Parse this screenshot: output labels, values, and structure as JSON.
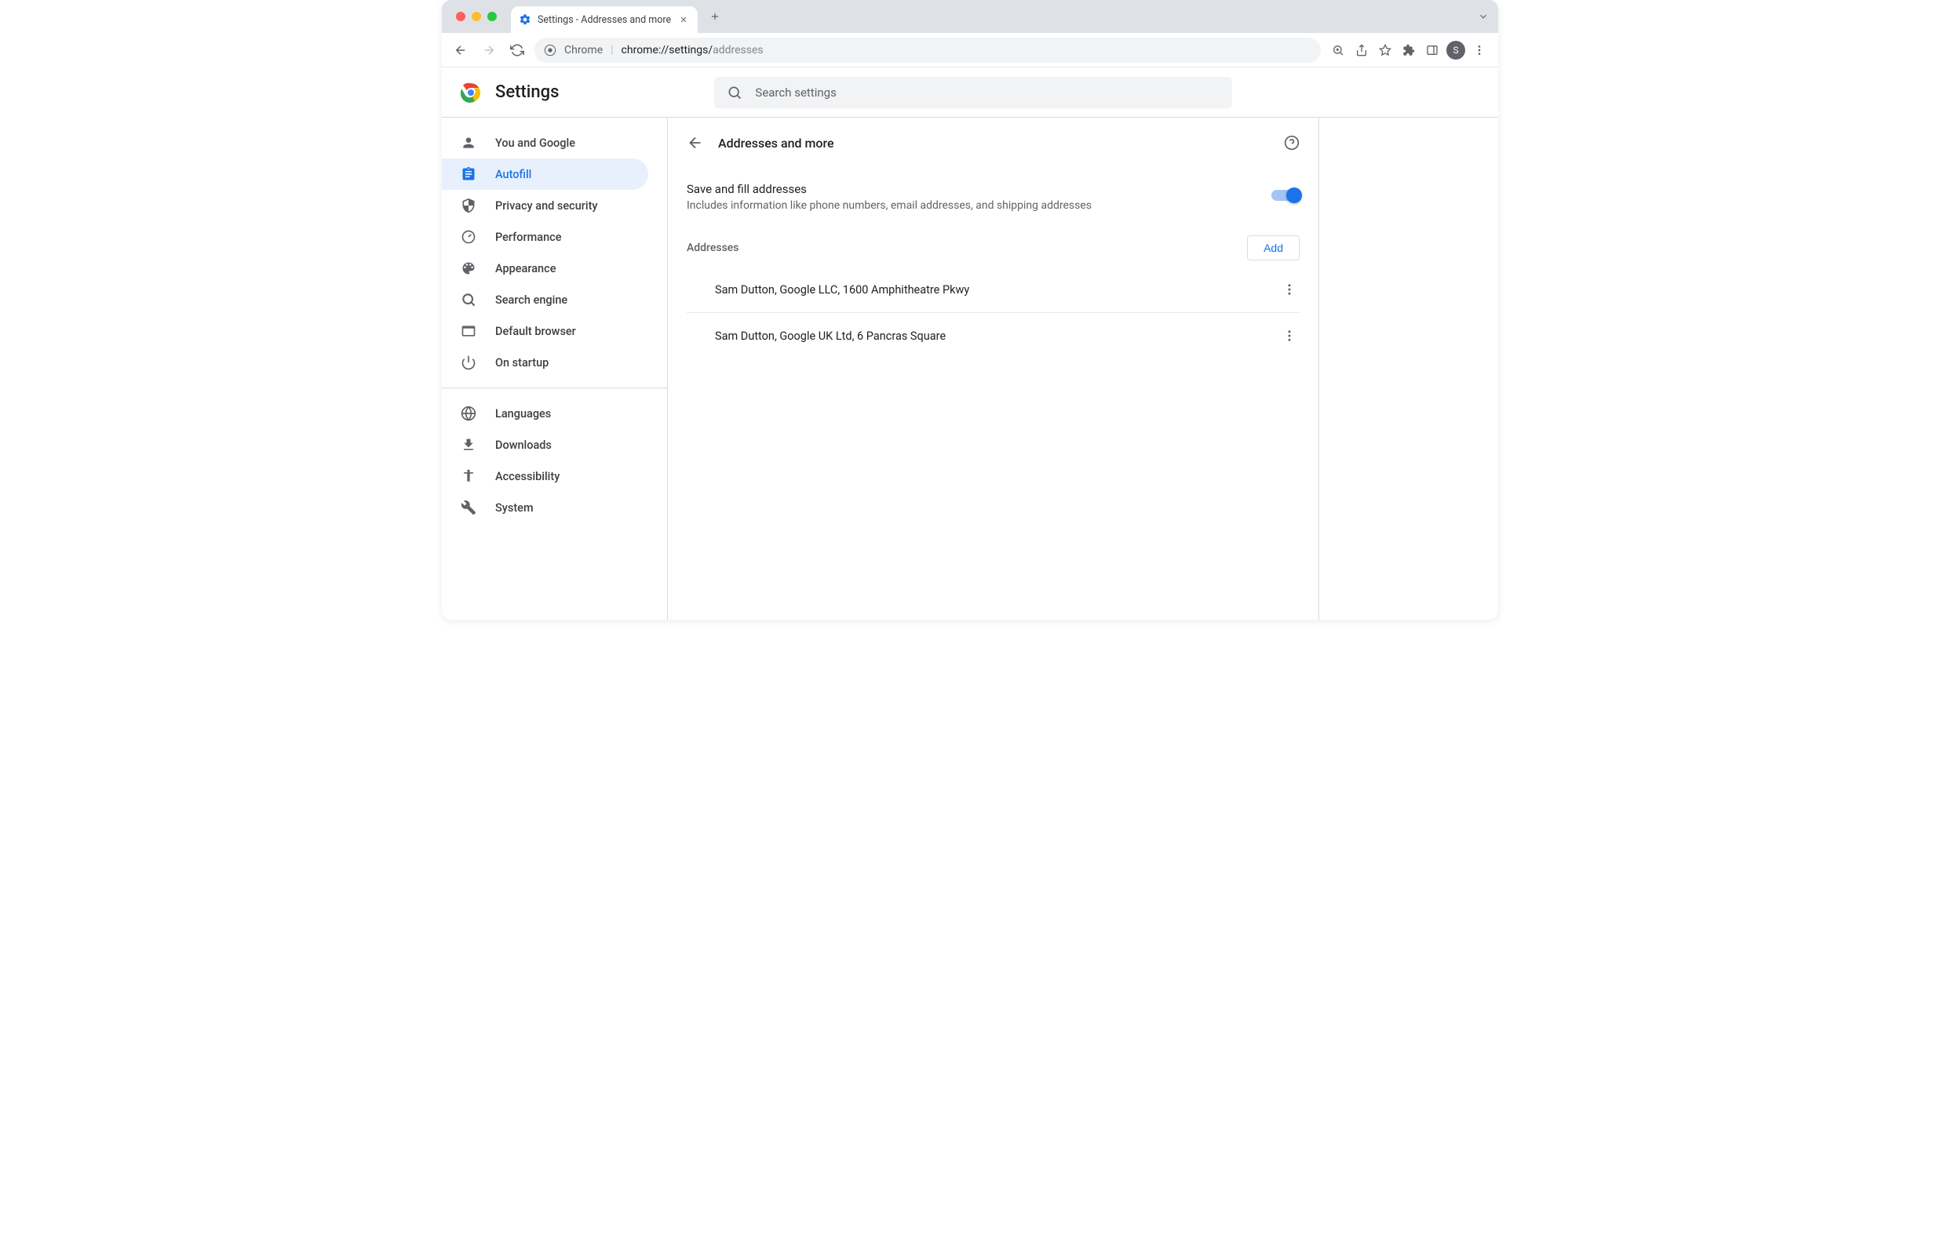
{
  "tab": {
    "title": "Settings - Addresses and more"
  },
  "omnibox": {
    "label": "Chrome",
    "url_prefix": "chrome://",
    "url_bold": "settings/",
    "url_faded": "addresses"
  },
  "avatar_initial": "S",
  "header": {
    "title": "Settings",
    "search_placeholder": "Search settings"
  },
  "sidebar": {
    "items": [
      {
        "label": "You and Google"
      },
      {
        "label": "Autofill"
      },
      {
        "label": "Privacy and security"
      },
      {
        "label": "Performance"
      },
      {
        "label": "Appearance"
      },
      {
        "label": "Search engine"
      },
      {
        "label": "Default browser"
      },
      {
        "label": "On startup"
      }
    ],
    "items2": [
      {
        "label": "Languages"
      },
      {
        "label": "Downloads"
      },
      {
        "label": "Accessibility"
      },
      {
        "label": "System"
      }
    ]
  },
  "page": {
    "title": "Addresses and more",
    "save_fill_label": "Save and fill addresses",
    "save_fill_desc": "Includes information like phone numbers, email addresses, and shipping addresses",
    "addresses_label": "Addresses",
    "add_label": "Add",
    "addresses": [
      {
        "text": "Sam Dutton, Google LLC, 1600 Amphitheatre Pkwy"
      },
      {
        "text": "Sam Dutton, Google UK Ltd, 6 Pancras Square"
      }
    ]
  }
}
